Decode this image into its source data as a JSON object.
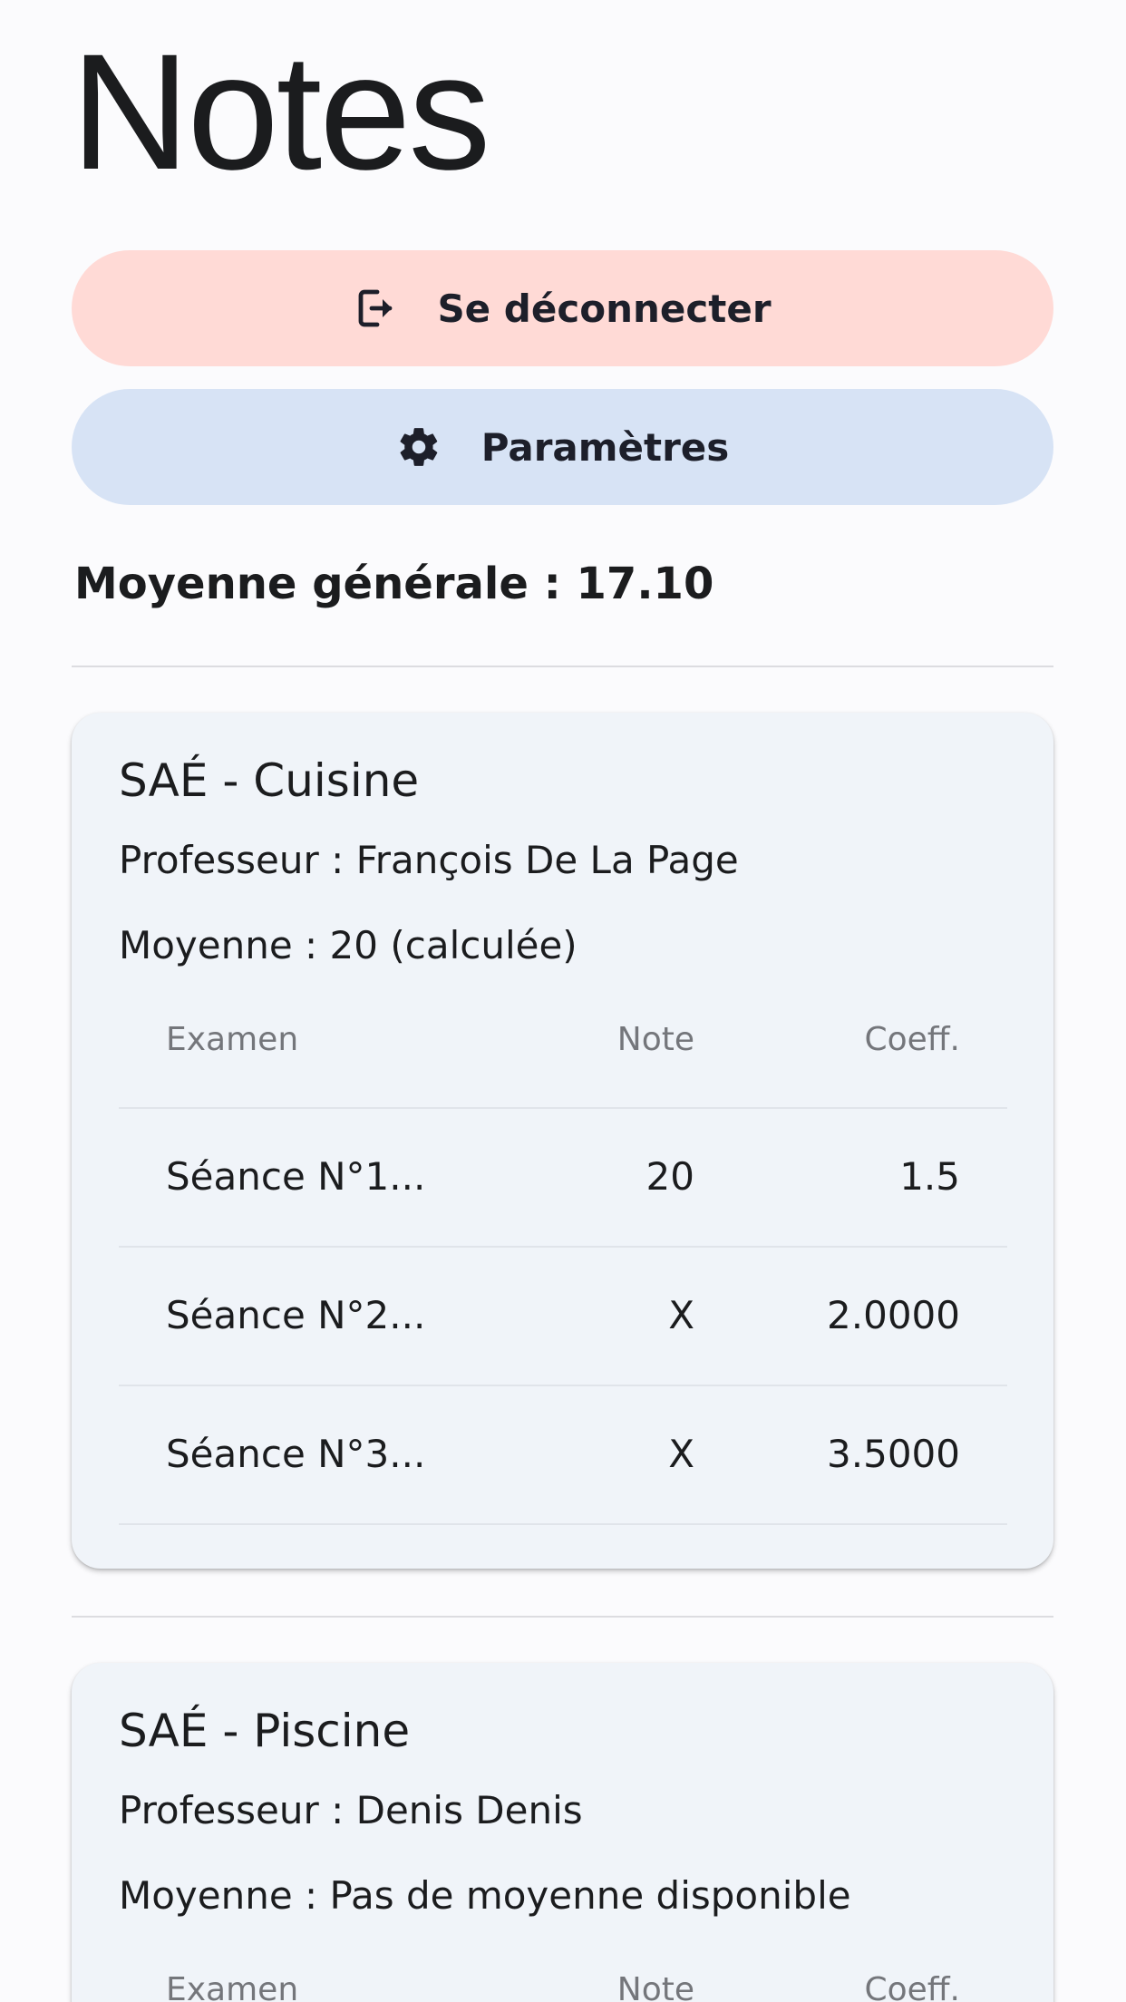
{
  "page": {
    "title": "Notes"
  },
  "actions": {
    "logout_label": "Se déconnecter",
    "logout_icon": "logout-icon",
    "settings_label": "Paramètres",
    "settings_icon": "gear-icon"
  },
  "overall": {
    "text": "Moyenne générale : 17.10"
  },
  "colors": {
    "logout_bg": "#ffdad6",
    "settings_bg": "#d7e3f5",
    "card_bg": "#f0f4f9",
    "page_bg": "#fbfbfd"
  },
  "courses": [
    {
      "title": "SAÉ - Cuisine",
      "teacher": "Professeur : François De La Page",
      "average": "Moyenne : 20 (calculée)",
      "headers": {
        "exam": "Examen",
        "note": "Note",
        "coef": "Coeff."
      },
      "rows": [
        {
          "exam": "Séance N°1...",
          "note": "20",
          "coef": "1.5"
        },
        {
          "exam": "Séance N°2...",
          "note": "X",
          "coef": "2.0000"
        },
        {
          "exam": "Séance N°3...",
          "note": "X",
          "coef": "3.5000"
        }
      ]
    },
    {
      "title": "SAÉ - Piscine",
      "teacher": "Professeur : Denis Denis",
      "average": "Moyenne : Pas de moyenne disponible",
      "headers": {
        "exam": "Examen",
        "note": "Note",
        "coef": "Coeff."
      },
      "rows": []
    }
  ]
}
